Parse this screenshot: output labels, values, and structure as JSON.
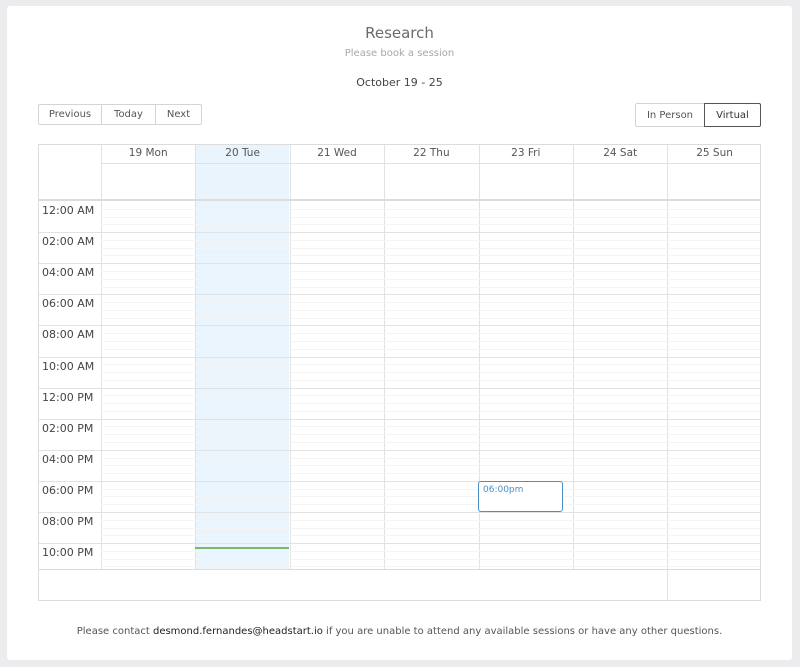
{
  "header": {
    "title": "Research",
    "subtitle": "Please book a session",
    "date_range": "October 19 - 25"
  },
  "nav": {
    "previous": "Previous",
    "today": "Today",
    "next": "Next"
  },
  "mode": {
    "in_person": "In Person",
    "virtual": "Virtual",
    "selected": "Virtual"
  },
  "calendar": {
    "days": [
      "19 Mon",
      "20 Tue",
      "21 Wed",
      "22 Thu",
      "23 Fri",
      "24 Sat",
      "25 Sun"
    ],
    "today_index": 1,
    "times": [
      "12:00 AM",
      "02:00 AM",
      "04:00 AM",
      "06:00 AM",
      "08:00 AM",
      "10:00 AM",
      "12:00 PM",
      "02:00 PM",
      "04:00 PM",
      "06:00 PM",
      "08:00 PM",
      "10:00 PM"
    ],
    "event": {
      "label": "06:00pm",
      "day": "23 Fri",
      "color": "#4a90c8"
    },
    "today_bg": "#e9f4fc",
    "now_indicator_color": "#7ab870"
  },
  "footer": {
    "prefix": "Please contact ",
    "email": "desmond.fernandes@headstart.io",
    "suffix": " if you are unable to attend any available sessions or have any other questions."
  }
}
